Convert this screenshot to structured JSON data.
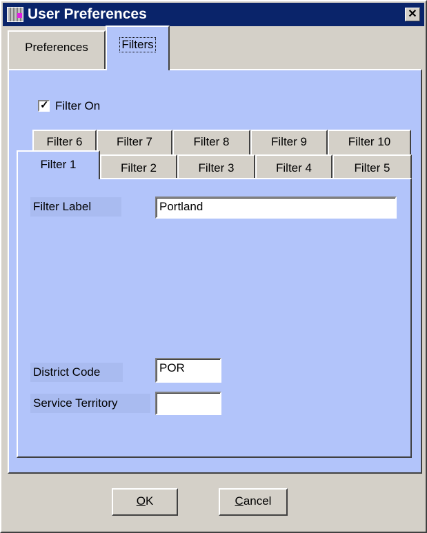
{
  "window": {
    "title": "User Preferences",
    "close_symbol": "✕"
  },
  "outer_tabs": [
    {
      "label": "Preferences"
    },
    {
      "label": "Filters"
    }
  ],
  "filters_panel": {
    "filter_on": {
      "label": "Filter On",
      "checked": true,
      "check_symbol": "✓"
    },
    "filter_tabs_back_row": [
      "Filter 6",
      "Filter 7",
      "Filter 8",
      "Filter 9",
      "Filter 10"
    ],
    "filter_tabs_front_row": [
      "Filter 1",
      "Filter 2",
      "Filter 3",
      "Filter 4",
      "Filter 5"
    ],
    "active_filter_tab": "Filter 1",
    "fields": {
      "filter_label": {
        "label": "Filter Label",
        "value": "Portland"
      },
      "district_code": {
        "label": "District Code",
        "value": "POR"
      },
      "service_territory": {
        "label": "Service Territory",
        "value": ""
      }
    }
  },
  "buttons": {
    "ok": {
      "mnemonic": "O",
      "rest": "K"
    },
    "cancel": {
      "mnemonic": "C",
      "rest": "ancel"
    }
  },
  "colors": {
    "titlebar": "#0a246a",
    "panel": "#b2c4fa",
    "face": "#d4d0c8"
  }
}
